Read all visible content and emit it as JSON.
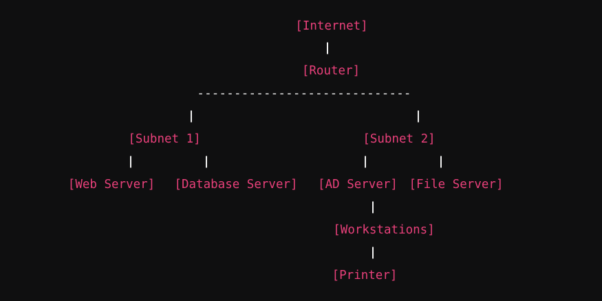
{
  "colors": {
    "background": "#0f0f10",
    "node_text": "#e8407a",
    "connector": "#f2f2f2"
  },
  "nodes": {
    "internet": "[Internet]",
    "router": "[Router]",
    "subnet1": "[Subnet 1]",
    "subnet2": "[Subnet 2]",
    "web_server": "[Web Server]",
    "database_server": "[Database Server]",
    "ad_server": "[AD Server]",
    "file_server": "[File Server]",
    "workstations": "[Workstations]",
    "printer": "[Printer]"
  },
  "branch_line": "-----------------------------"
}
